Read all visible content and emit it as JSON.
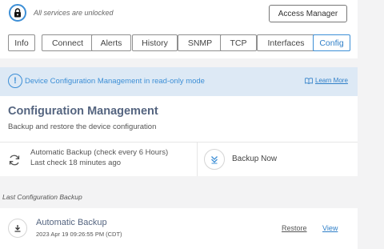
{
  "header": {
    "unlocked_text": "All services are unlocked",
    "access_manager_label": "Access Manager"
  },
  "tabs": [
    {
      "label": "Info",
      "active": false
    },
    {
      "label": "Connect",
      "active": false
    },
    {
      "label": "Alerts",
      "active": false
    },
    {
      "label": "History",
      "active": false
    },
    {
      "label": "SNMP",
      "active": false
    },
    {
      "label": "TCP",
      "active": false
    },
    {
      "label": "Interfaces",
      "active": false
    },
    {
      "label": "Config",
      "active": true
    }
  ],
  "banner": {
    "icon": "!",
    "text": "Device Configuration Management in read-only mode",
    "learn_more": "Learn More"
  },
  "config": {
    "title": "Configuration Management",
    "subtitle": "Backup and restore the device configuration",
    "auto_backup_line1": "Automatic Backup (check every 6 Hours)",
    "auto_backup_line2": "Last check 18 minutes ago",
    "backup_now_label": "Backup Now"
  },
  "last_backup": {
    "section_label": "Last Configuration Backup",
    "title": "Automatic Backup",
    "date": "2023 Apr 19 09:26:55 PM (CDT)",
    "restore_label": "Restore",
    "view_label": "View"
  },
  "colors": {
    "accent": "#3d8fd6",
    "banner_bg": "#dde9f5",
    "title": "#556580",
    "page_bg": "#f3f3f4"
  }
}
